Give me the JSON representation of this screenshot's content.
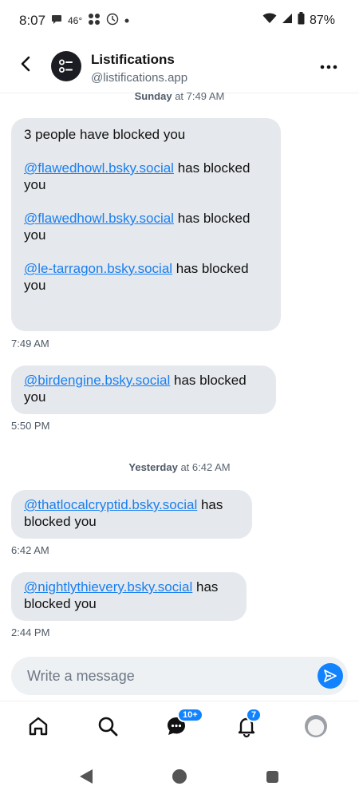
{
  "status_bar": {
    "time": "8:07",
    "temperature": "46°",
    "battery": "87%"
  },
  "header": {
    "back_icon": "chevron-left-icon",
    "title": "Listifications",
    "handle": "@listifications.app",
    "more_icon": "more-horizontal-icon"
  },
  "messages": {
    "date_sep_1": {
      "day": "Sunday",
      "rest": " at 7:49 AM"
    },
    "msg1": {
      "intro": "3 people have blocked you",
      "lines": [
        {
          "mention": "@flawedhowl.bsky.social",
          "text": " has blocked you"
        },
        {
          "mention": "@flawedhowl.bsky.social",
          "text": " has blocked you"
        },
        {
          "mention": "@le-tarragon.bsky.social",
          "text": " has blocked you"
        }
      ],
      "time": "7:49 AM"
    },
    "msg2": {
      "mention": "@birdengine.bsky.social",
      "text": " has blocked you",
      "time": "5:50 PM"
    },
    "date_sep_2": {
      "day": "Yesterday",
      "rest": " at 6:42 AM"
    },
    "msg3": {
      "mention": "@thatlocalcryptid.bsky.social",
      "text": " has blocked you",
      "time": "6:42 AM"
    },
    "msg4": {
      "mention": "@nightlythievery.bsky.social",
      "text": " has blocked you",
      "time": "2:44 PM"
    }
  },
  "composer": {
    "placeholder": "Write a message",
    "send_icon": "send-icon"
  },
  "bottom_nav": {
    "home_icon": "home-icon",
    "search_icon": "search-icon",
    "chat_icon": "chat-icon",
    "chat_badge": "10+",
    "notifications_icon": "bell-icon",
    "notifications_badge": "7",
    "profile_icon": "avatar"
  },
  "colors": {
    "accent": "#1283ff",
    "bubble": "#e5e8ec",
    "link": "#1a7ff0"
  }
}
